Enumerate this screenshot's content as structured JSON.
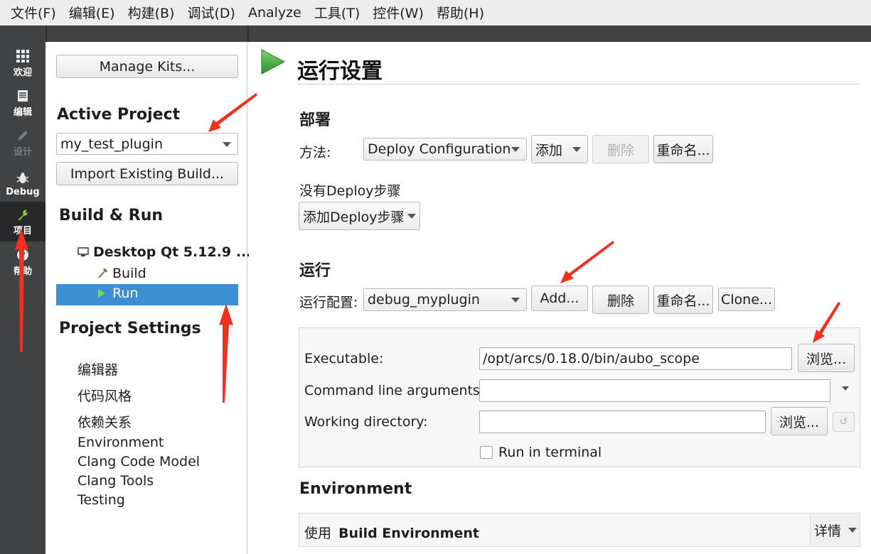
{
  "menu": [
    "文件(F)",
    "编辑(E)",
    "构建(B)",
    "调试(D)",
    "Analyze",
    "工具(T)",
    "控件(W)",
    "帮助(H)"
  ],
  "modes": [
    {
      "label": "欢迎",
      "icon": "grid-icon"
    },
    {
      "label": "编辑",
      "icon": "document-icon"
    },
    {
      "label": "设计",
      "icon": "pencil-icon"
    },
    {
      "label": "Debug",
      "icon": "bug-icon"
    },
    {
      "label": "项目",
      "icon": "wrench-icon"
    },
    {
      "label": "帮助",
      "icon": "help-icon"
    }
  ],
  "left": {
    "manage_kits": "Manage Kits...",
    "active_project_heading": "Active Project",
    "active_project_value": "my_test_plugin",
    "import_build": "Import Existing Build...",
    "build_run_heading": "Build & Run",
    "kit_name": "Desktop Qt 5.12.9 ...",
    "build_item": "Build",
    "run_item": "Run",
    "project_settings_heading": "Project Settings",
    "settings_items": [
      "编辑器",
      "代码风格",
      "依赖关系",
      "Environment",
      "Clang Code Model",
      "Clang Tools",
      "Testing"
    ]
  },
  "content": {
    "page_title": "运行设置",
    "deploy": {
      "heading": "部署",
      "method_label": "方法:",
      "method_value": "Deploy Configuration",
      "add": "添加",
      "delete": "删除",
      "rename": "重命名...",
      "no_steps": "没有Deploy步骤",
      "add_step": "添加Deploy步骤"
    },
    "run": {
      "heading": "运行",
      "config_label": "运行配置:",
      "config_value": "debug_myplugin",
      "add": "Add...",
      "delete": "删除",
      "rename": "重命名...",
      "clone": "Clone...",
      "executable_label": "Executable:",
      "executable_value": "/opt/arcs/0.18.0/bin/aubo_scope",
      "browse": "浏览...",
      "args_label": "Command line arguments:",
      "args_value": "",
      "workdir_label": "Working directory:",
      "workdir_value": "",
      "browse2": "浏览...",
      "run_in_terminal": "Run in terminal"
    },
    "environment": {
      "heading": "Environment",
      "prefix": "使用",
      "value": "Build Environment",
      "details": "详情"
    }
  },
  "colors": {
    "selection": "#3c8fd3",
    "sidebar": "#404244",
    "annotation": "#f3301f",
    "run_green": "#3aa83a"
  }
}
